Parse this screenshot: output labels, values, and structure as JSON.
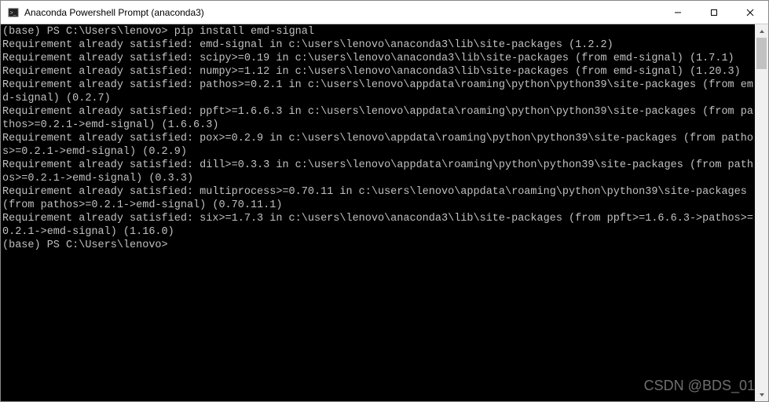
{
  "window": {
    "title": "Anaconda Powershell Prompt (anaconda3)"
  },
  "prompt": {
    "prefix1": "(base) PS C:\\Users\\lenovo> ",
    "command": "pip install emd-signal",
    "prefix2": "(base) PS C:\\Users\\lenovo>"
  },
  "output": {
    "lines": [
      "Requirement already satisfied: emd-signal in c:\\users\\lenovo\\anaconda3\\lib\\site-packages (1.2.2)",
      "Requirement already satisfied: scipy>=0.19 in c:\\users\\lenovo\\anaconda3\\lib\\site-packages (from emd-signal) (1.7.1)",
      "Requirement already satisfied: numpy>=1.12 in c:\\users\\lenovo\\anaconda3\\lib\\site-packages (from emd-signal) (1.20.3)",
      "Requirement already satisfied: pathos>=0.2.1 in c:\\users\\lenovo\\appdata\\roaming\\python\\python39\\site-packages (from emd-signal) (0.2.7)",
      "Requirement already satisfied: ppft>=1.6.6.3 in c:\\users\\lenovo\\appdata\\roaming\\python\\python39\\site-packages (from pathos>=0.2.1->emd-signal) (1.6.6.3)",
      "Requirement already satisfied: pox>=0.2.9 in c:\\users\\lenovo\\appdata\\roaming\\python\\python39\\site-packages (from pathos>=0.2.1->emd-signal) (0.2.9)",
      "Requirement already satisfied: dill>=0.3.3 in c:\\users\\lenovo\\appdata\\roaming\\python\\python39\\site-packages (from pathos>=0.2.1->emd-signal) (0.3.3)",
      "Requirement already satisfied: multiprocess>=0.70.11 in c:\\users\\lenovo\\appdata\\roaming\\python\\python39\\site-packages (from pathos>=0.2.1->emd-signal) (0.70.11.1)",
      "Requirement already satisfied: six>=1.7.3 in c:\\users\\lenovo\\anaconda3\\lib\\site-packages (from ppft>=1.6.6.3->pathos>=0.2.1->emd-signal) (1.16.0)"
    ]
  },
  "watermark": "CSDN @BDS_01"
}
